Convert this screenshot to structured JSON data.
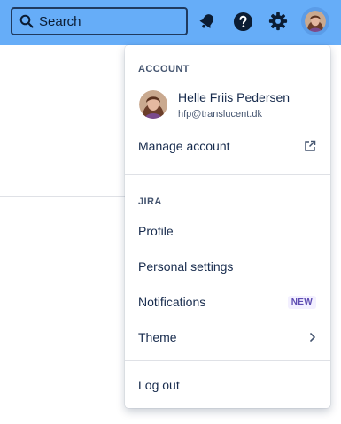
{
  "header": {
    "search_placeholder": "Search",
    "icons": [
      "search-icon",
      "notification-bell-icon",
      "help-icon",
      "settings-gear-icon",
      "avatar"
    ],
    "bar_color": "#66adf8"
  },
  "menu": {
    "account_section": {
      "title": "ACCOUNT",
      "user_name": "Helle Friis Pedersen",
      "user_email": "hfp@translucent.dk",
      "manage_label": "Manage account",
      "manage_icon": "external-link-icon"
    },
    "jira_section": {
      "title": "JIRA",
      "profile_label": "Profile",
      "personal_settings_label": "Personal settings",
      "notifications_label": "Notifications",
      "notifications_badge": "NEW",
      "theme_label": "Theme",
      "theme_icon": "chevron-right-icon"
    },
    "logout_label": "Log out"
  }
}
